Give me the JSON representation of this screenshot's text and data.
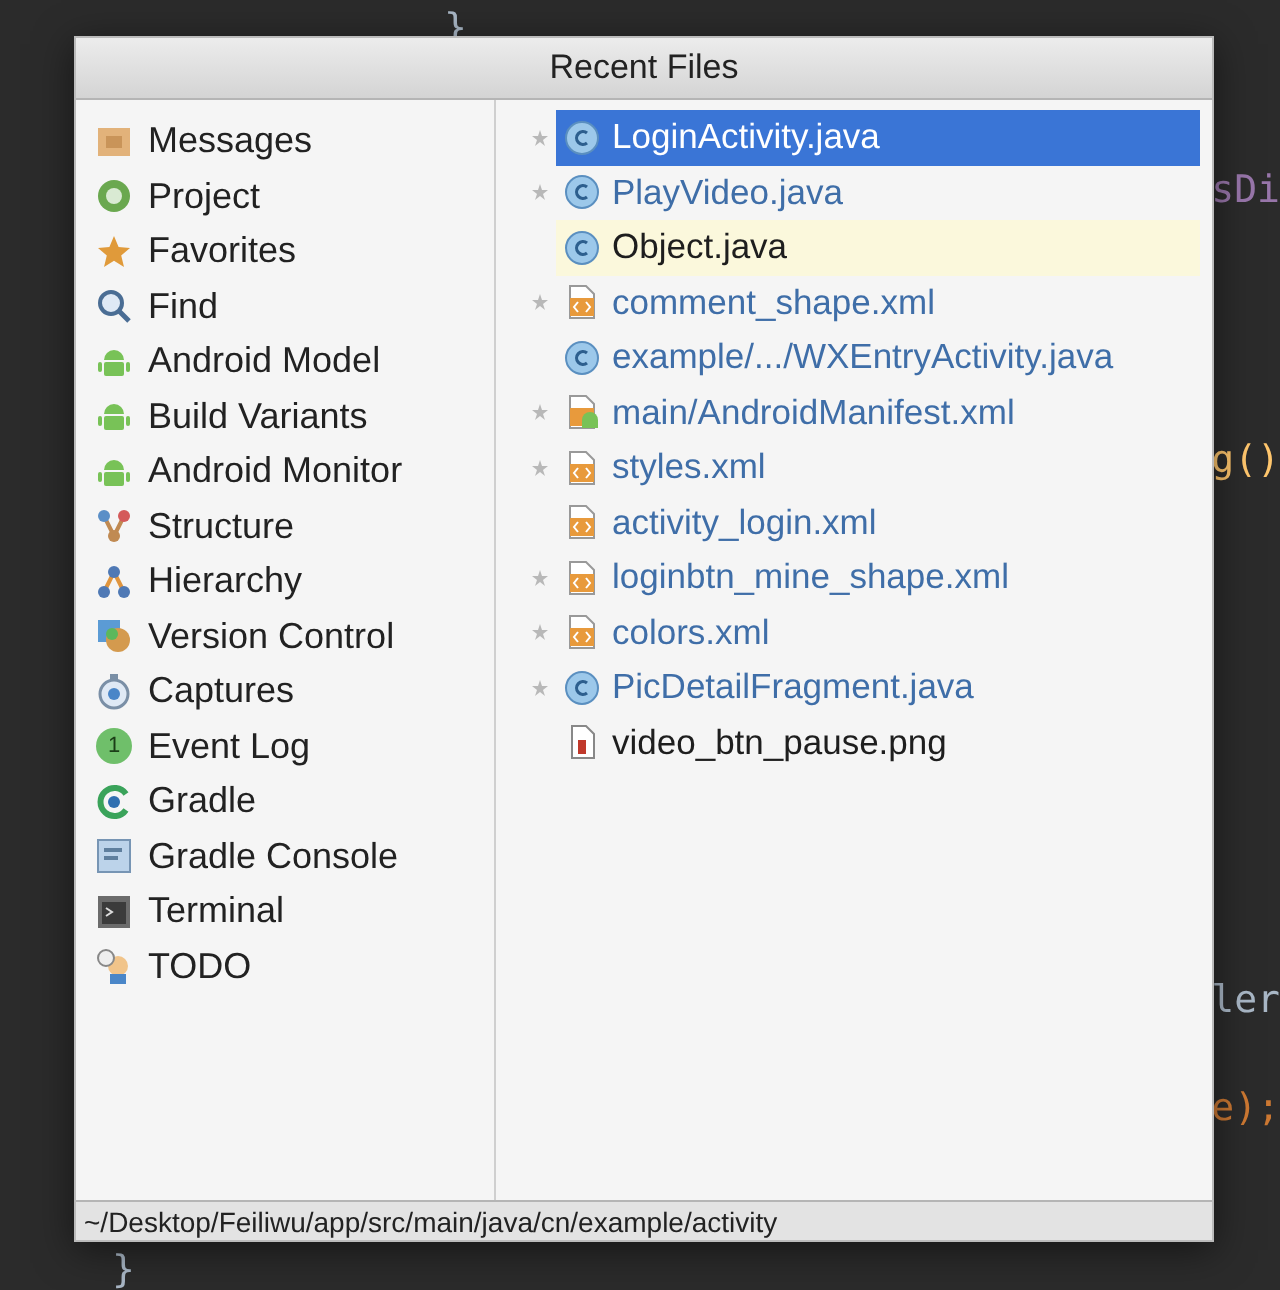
{
  "editor": {
    "top_brace": "}",
    "edge_fragments": [
      "sDi",
      "g()",
      "ler",
      "e);"
    ],
    "bottom_brace": "}"
  },
  "popup": {
    "title": "Recent Files",
    "tool_windows": [
      {
        "label": "Messages",
        "kind": "messages"
      },
      {
        "label": "Project",
        "kind": "project"
      },
      {
        "label": "Favorites",
        "kind": "favorites"
      },
      {
        "label": "Find",
        "kind": "find"
      },
      {
        "label": "Android Model",
        "kind": "android"
      },
      {
        "label": "Build Variants",
        "kind": "android"
      },
      {
        "label": "Android Monitor",
        "kind": "android"
      },
      {
        "label": "Structure",
        "kind": "structure"
      },
      {
        "label": "Hierarchy",
        "kind": "hierarchy"
      },
      {
        "label": "Version Control",
        "kind": "vcs"
      },
      {
        "label": "Captures",
        "kind": "captures"
      },
      {
        "label": "Event Log",
        "kind": "eventlog",
        "badge": "1"
      },
      {
        "label": "Gradle",
        "kind": "gradle"
      },
      {
        "label": "Gradle Console",
        "kind": "console"
      },
      {
        "label": "Terminal",
        "kind": "terminal"
      },
      {
        "label": "TODO",
        "kind": "todo"
      }
    ],
    "files": [
      {
        "name": "LoginActivity.java",
        "kind": "java",
        "modified": true,
        "selected": true,
        "highlighted": false
      },
      {
        "name": "PlayVideo.java",
        "kind": "java",
        "modified": true,
        "selected": false,
        "highlighted": false,
        "color": "#3f6ea8"
      },
      {
        "name": "Object.java",
        "kind": "java",
        "modified": false,
        "selected": false,
        "highlighted": true,
        "color": "#1e1e1e"
      },
      {
        "name": "comment_shape.xml",
        "kind": "xml",
        "modified": true,
        "selected": false,
        "highlighted": false,
        "color": "#3f6ea8"
      },
      {
        "name": "example/.../WXEntryActivity.java",
        "kind": "java",
        "modified": false,
        "selected": false,
        "highlighted": false,
        "color": "#3f6ea8"
      },
      {
        "name": "main/AndroidManifest.xml",
        "kind": "manifest",
        "modified": true,
        "selected": false,
        "highlighted": false,
        "color": "#3f6ea8"
      },
      {
        "name": "styles.xml",
        "kind": "xml",
        "modified": true,
        "selected": false,
        "highlighted": false,
        "color": "#3f6ea8"
      },
      {
        "name": "activity_login.xml",
        "kind": "xml",
        "modified": false,
        "selected": false,
        "highlighted": false,
        "color": "#3f6ea8"
      },
      {
        "name": "loginbtn_mine_shape.xml",
        "kind": "xml",
        "modified": true,
        "selected": false,
        "highlighted": false,
        "color": "#3f6ea8"
      },
      {
        "name": "colors.xml",
        "kind": "xml",
        "modified": true,
        "selected": false,
        "highlighted": false,
        "color": "#3f6ea8"
      },
      {
        "name": "PicDetailFragment.java",
        "kind": "java",
        "modified": true,
        "selected": false,
        "highlighted": false,
        "color": "#3f6ea8"
      },
      {
        "name": "video_btn_pause.png",
        "kind": "png",
        "modified": false,
        "selected": false,
        "highlighted": false,
        "color": "#1e1e1e"
      }
    ],
    "path": "~/Desktop/Feiliwu/app/src/main/java/cn/example/activity"
  }
}
